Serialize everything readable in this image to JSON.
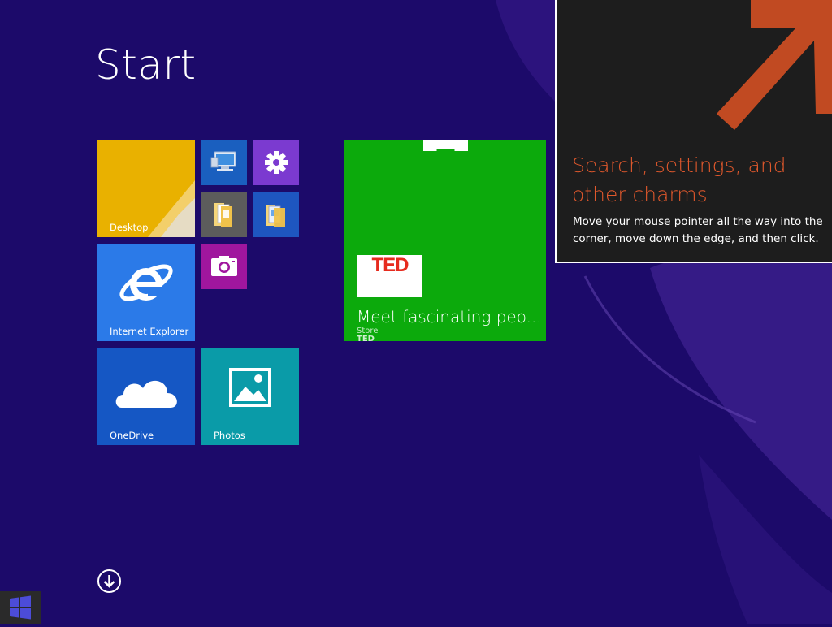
{
  "screen": {
    "title": "Start",
    "background_color": "#1c0a6a"
  },
  "tiles": {
    "desktop": {
      "label": "Desktop",
      "color": "#e9b100"
    },
    "internet_explorer": {
      "label": "Internet Explorer",
      "color": "#2b7ae8"
    },
    "onedrive": {
      "label": "OneDrive",
      "color": "#1557c4"
    },
    "photos": {
      "label": "Photos",
      "color": "#0a9ba8"
    },
    "store": {
      "label": "Store",
      "headline": "Meet fascinating peo...",
      "app_logo": "TED",
      "app_name": "TED",
      "color": "#0caa0c"
    },
    "small": [
      {
        "icon": "this-pc-icon",
        "color": "#1a5fbf"
      },
      {
        "icon": "settings-gear-icon",
        "color": "#7b3ad0"
      },
      {
        "icon": "file-explorer-icon",
        "color": "#5c5c5c"
      },
      {
        "icon": "documents-folder-icon",
        "color": "#1e56c0"
      },
      {
        "icon": "camera-icon",
        "color": "#a0169e"
      }
    ]
  },
  "charm_tip": {
    "heading": "Search, settings, and other charms",
    "body": "Move your mouse pointer all the way into the corner, move down the edge, and then click.",
    "accent_color": "#e0582c"
  },
  "bottom": {
    "all_apps_icon": "down-arrow-circle-icon",
    "start_icon": "windows-logo-icon"
  }
}
